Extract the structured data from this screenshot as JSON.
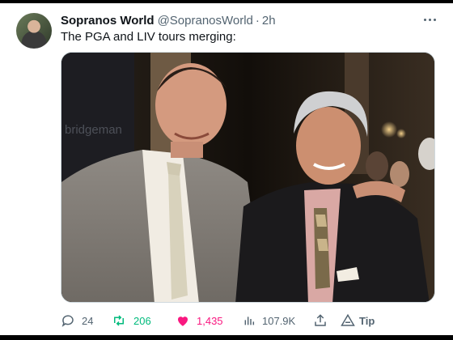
{
  "tweet": {
    "author_name": "Sopranos World",
    "author_handle": "@SopranosWorld",
    "separator": "·",
    "time": "2h",
    "text": "The PGA and LIV tours merging:"
  },
  "actions": {
    "replies": "24",
    "retweets": "206",
    "likes": "1,435",
    "views": "107.9K",
    "tip_label": "Tip"
  },
  "media": {
    "watermark": "bridgeman"
  },
  "colors": {
    "retweet": "#00ba7c",
    "like": "#f91880",
    "muted": "#536471"
  }
}
